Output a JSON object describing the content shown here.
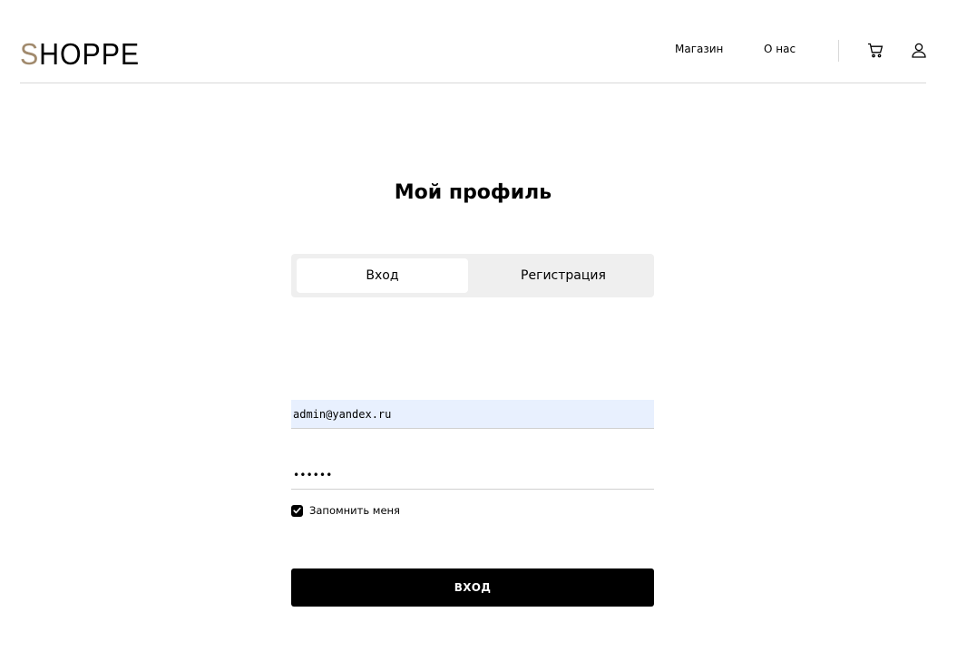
{
  "header": {
    "logo_accent": "S",
    "logo_rest": "HOPPE",
    "nav": {
      "shop": "Магазин",
      "about": "О нас"
    },
    "icons": {
      "cart": "cart-icon",
      "user": "user-icon"
    }
  },
  "main": {
    "title": "Мой профиль",
    "tabs": {
      "login": "Вход",
      "register": "Регистрация"
    },
    "email_value": "admin@yandex.ru",
    "password_value": "••••••",
    "remember_label": "Запомнить меня",
    "remember_checked": true,
    "submit_label": "ВХОД"
  },
  "colors": {
    "accent": "#a18a6d",
    "primary": "#000000",
    "autofill": "#e8f0fe",
    "tab_bg": "#efefef"
  }
}
